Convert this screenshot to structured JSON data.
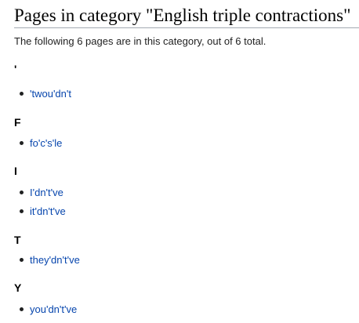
{
  "page": {
    "title": "Pages in category \"English triple contractions\"",
    "intro": "The following 6 pages are in this category, out of 6 total."
  },
  "groups": [
    {
      "letter": "'",
      "items": [
        "'twou'dn't"
      ]
    },
    {
      "letter": "F",
      "items": [
        "fo'c's'le"
      ]
    },
    {
      "letter": "I",
      "items": [
        "I'dn't've",
        "it'dn't've"
      ]
    },
    {
      "letter": "T",
      "items": [
        "they'dn't've"
      ]
    },
    {
      "letter": "Y",
      "items": [
        "you'dn't've"
      ]
    }
  ],
  "colors": {
    "link": "#0645ad",
    "text": "#222222",
    "rule": "#a2a9b1"
  }
}
